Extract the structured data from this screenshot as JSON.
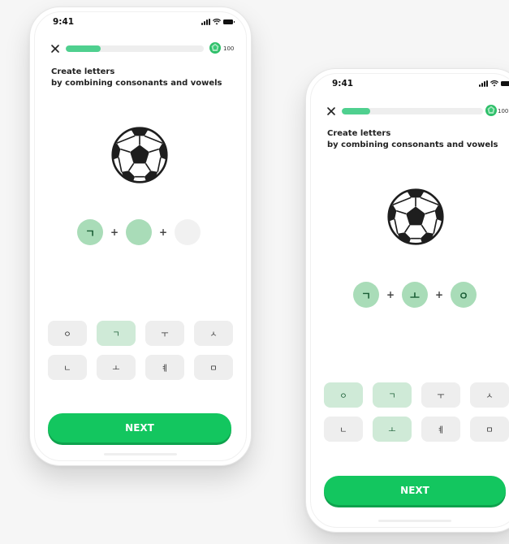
{
  "status": {
    "time": "9:41"
  },
  "score": "100",
  "instruction": {
    "line1": "Create letters",
    "line2": "by combining consonants and vowels"
  },
  "next_label": "NEXT",
  "phones": [
    {
      "progress": 0.25,
      "slots": [
        {
          "state": "filled",
          "glyph": "ㄱ"
        },
        {
          "state": "active",
          "glyph": ""
        },
        {
          "state": "empty",
          "glyph": ""
        }
      ],
      "keys": [
        {
          "glyph": "ㅇ",
          "selected": false
        },
        {
          "glyph": "ㄱ",
          "selected": true
        },
        {
          "glyph": "ㅜ",
          "selected": false
        },
        {
          "glyph": "ㅅ",
          "selected": false
        },
        {
          "glyph": "ㄴ",
          "selected": false
        },
        {
          "glyph": "ㅗ",
          "selected": false
        },
        {
          "glyph": "ㅖ",
          "selected": false
        },
        {
          "glyph": "ㅁ",
          "selected": false
        }
      ]
    },
    {
      "progress": 0.2,
      "slots": [
        {
          "state": "filled",
          "glyph": "ㄱ"
        },
        {
          "state": "filled",
          "glyph": "ㅗ"
        },
        {
          "state": "filled",
          "glyph": "ㅇ"
        }
      ],
      "keys": [
        {
          "glyph": "ㅇ",
          "selected": true
        },
        {
          "glyph": "ㄱ",
          "selected": true
        },
        {
          "glyph": "ㅜ",
          "selected": false
        },
        {
          "glyph": "ㅅ",
          "selected": false
        },
        {
          "glyph": "ㄴ",
          "selected": false
        },
        {
          "glyph": "ㅗ",
          "selected": true
        },
        {
          "glyph": "ㅖ",
          "selected": false
        },
        {
          "glyph": "ㅁ",
          "selected": false
        }
      ]
    }
  ],
  "colors": {
    "accent": "#13c65f",
    "progress": "#4fd08f",
    "slot_fill": "#a9dcb8",
    "key_selected": "#cfead7"
  },
  "icons": [
    "close-icon",
    "gem-icon",
    "soccer-ball-icon",
    "signal-icon",
    "wifi-icon",
    "battery-icon"
  ]
}
